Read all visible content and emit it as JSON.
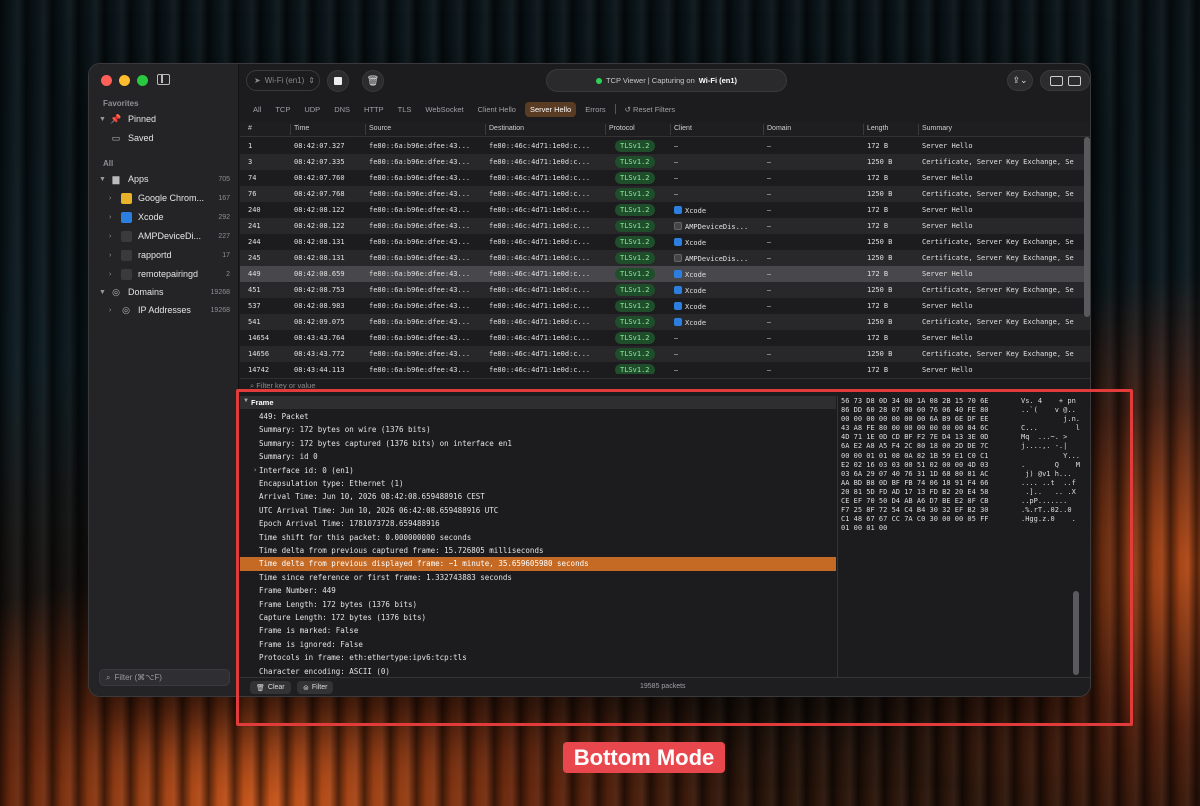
{
  "sidebar": {
    "favorites_heading": "Favorites",
    "pinned": "Pinned",
    "saved": "Saved",
    "all_heading": "All",
    "apps": {
      "label": "Apps",
      "count": "705"
    },
    "app_items": [
      {
        "label": "Google Chrom...",
        "count": "167",
        "color": "#e8b32a"
      },
      {
        "label": "Xcode",
        "count": "292",
        "color": "#2a7fe0"
      },
      {
        "label": "AMPDeviceDi...",
        "count": "227",
        "color": "#3a3a3a"
      },
      {
        "label": "rapportd",
        "count": "17",
        "color": "#3a3a3a"
      },
      {
        "label": "remotepairingd",
        "count": "2",
        "color": "#3a3a3a"
      }
    ],
    "domains": {
      "label": "Domains",
      "count": "19268"
    },
    "ip": {
      "label": "IP Addresses",
      "count": "19268"
    },
    "filter_placeholder": "Filter (⌘⌥F)"
  },
  "toolbar": {
    "interface": "Wi-Fi (en1)",
    "status_prefix": "TCP Viewer | Capturing on",
    "status_iface": "Wi-Fi (en1)"
  },
  "tabs": [
    "All",
    "TCP",
    "UDP",
    "DNS",
    "HTTP",
    "TLS",
    "WebSocket",
    "Client Hello",
    "Server Hello",
    "Errors"
  ],
  "reset_filters": "Reset Filters",
  "table": {
    "headers": [
      "#",
      "Time",
      "Source",
      "Destination",
      "Protocol",
      "Client",
      "Domain",
      "Length",
      "Summary"
    ],
    "rows": [
      {
        "n": "1",
        "time": "08:42:07.327",
        "src": "fe80::6a:b96e:dfee:43...",
        "dst": "fe80::46c:4d71:1e0d:c...",
        "proto": "TLSv1.2",
        "client": "–",
        "client_icon": "",
        "domain": "–",
        "len": "172 B",
        "summary": "Server Hello"
      },
      {
        "n": "3",
        "time": "08:42:07.335",
        "src": "fe80::6a:b96e:dfee:43...",
        "dst": "fe80::46c:4d71:1e0d:c...",
        "proto": "TLSv1.2",
        "client": "–",
        "client_icon": "",
        "domain": "–",
        "len": "1250 B",
        "summary": "Certificate, Server Key Exchange, Se"
      },
      {
        "n": "74",
        "time": "08:42:07.760",
        "src": "fe80::6a:b96e:dfee:43...",
        "dst": "fe80::46c:4d71:1e0d:c...",
        "proto": "TLSv1.2",
        "client": "–",
        "client_icon": "",
        "domain": "–",
        "len": "172 B",
        "summary": "Server Hello"
      },
      {
        "n": "76",
        "time": "08:42:07.768",
        "src": "fe80::6a:b96e:dfee:43...",
        "dst": "fe80::46c:4d71:1e0d:c...",
        "proto": "TLSv1.2",
        "client": "–",
        "client_icon": "",
        "domain": "–",
        "len": "1250 B",
        "summary": "Certificate, Server Key Exchange, Se"
      },
      {
        "n": "240",
        "time": "08:42:08.122",
        "src": "fe80::6a:b96e:dfee:43...",
        "dst": "fe80::46c:4d71:1e0d:c...",
        "proto": "TLSv1.2",
        "client": "Xcode",
        "client_icon": "xc",
        "domain": "–",
        "len": "172 B",
        "summary": "Server Hello"
      },
      {
        "n": "241",
        "time": "08:42:08.122",
        "src": "fe80::6a:b96e:dfee:43...",
        "dst": "fe80::46c:4d71:1e0d:c...",
        "proto": "TLSv1.2",
        "client": "AMPDeviceDis...",
        "client_icon": "amp",
        "domain": "–",
        "len": "172 B",
        "summary": "Server Hello"
      },
      {
        "n": "244",
        "time": "08:42:08.131",
        "src": "fe80::6a:b96e:dfee:43...",
        "dst": "fe80::46c:4d71:1e0d:c...",
        "proto": "TLSv1.2",
        "client": "Xcode",
        "client_icon": "xc",
        "domain": "–",
        "len": "1250 B",
        "summary": "Certificate, Server Key Exchange, Se"
      },
      {
        "n": "245",
        "time": "08:42:08.131",
        "src": "fe80::6a:b96e:dfee:43...",
        "dst": "fe80::46c:4d71:1e0d:c...",
        "proto": "TLSv1.2",
        "client": "AMPDeviceDis...",
        "client_icon": "amp",
        "domain": "–",
        "len": "1250 B",
        "summary": "Certificate, Server Key Exchange, Se"
      },
      {
        "n": "449",
        "time": "08:42:08.659",
        "src": "fe80::6a:b96e:dfee:43...",
        "dst": "fe80::46c:4d71:1e0d:c...",
        "proto": "TLSv1.2",
        "client": "Xcode",
        "client_icon": "xc",
        "domain": "–",
        "len": "172 B",
        "summary": "Server Hello"
      },
      {
        "n": "451",
        "time": "08:42:08.753",
        "src": "fe80::6a:b96e:dfee:43...",
        "dst": "fe80::46c:4d71:1e0d:c...",
        "proto": "TLSv1.2",
        "client": "Xcode",
        "client_icon": "xc",
        "domain": "–",
        "len": "1250 B",
        "summary": "Certificate, Server Key Exchange, Se"
      },
      {
        "n": "537",
        "time": "08:42:08.983",
        "src": "fe80::6a:b96e:dfee:43...",
        "dst": "fe80::46c:4d71:1e0d:c...",
        "proto": "TLSv1.2",
        "client": "Xcode",
        "client_icon": "xc",
        "domain": "–",
        "len": "172 B",
        "summary": "Server Hello"
      },
      {
        "n": "541",
        "time": "08:42:09.075",
        "src": "fe80::6a:b96e:dfee:43...",
        "dst": "fe80::46c:4d71:1e0d:c...",
        "proto": "TLSv1.2",
        "client": "Xcode",
        "client_icon": "xc",
        "domain": "–",
        "len": "1250 B",
        "summary": "Certificate, Server Key Exchange, Se"
      },
      {
        "n": "14654",
        "time": "08:43:43.764",
        "src": "fe80::6a:b96e:dfee:43...",
        "dst": "fe80::46c:4d71:1e0d:c...",
        "proto": "TLSv1.2",
        "client": "–",
        "client_icon": "",
        "domain": "–",
        "len": "172 B",
        "summary": "Server Hello"
      },
      {
        "n": "14656",
        "time": "08:43:43.772",
        "src": "fe80::6a:b96e:dfee:43...",
        "dst": "fe80::46c:4d71:1e0d:c...",
        "proto": "TLSv1.2",
        "client": "–",
        "client_icon": "",
        "domain": "–",
        "len": "1250 B",
        "summary": "Certificate, Server Key Exchange, Se"
      },
      {
        "n": "14742",
        "time": "08:43:44.113",
        "src": "fe80::6a:b96e:dfee:43...",
        "dst": "fe80::46c:4d71:1e0d:c...",
        "proto": "TLSv1.2",
        "client": "–",
        "client_icon": "",
        "domain": "–",
        "len": "172 B",
        "summary": "Server Hello"
      }
    ]
  },
  "filter_key_placeholder": "Filter key or value",
  "detail": {
    "frame_label": "Frame",
    "lines": [
      "449: Packet",
      "Summary: 172 bytes on wire (1376 bits)",
      "Summary: 172 bytes captured (1376 bits) on interface en1",
      "Summary: id 0",
      "Interface id: 0 (en1)",
      "Encapsulation type: Ethernet (1)",
      "Arrival Time: Jun 10, 2026 08:42:08.659488916 CEST",
      "UTC Arrival Time: Jun 10, 2026 06:42:08.659488916 UTC",
      "Epoch Arrival Time: 1781073728.659488916",
      "Time shift for this packet: 0.000000000 seconds",
      "Time delta from previous captured frame: 15.726805 milliseconds",
      "Time delta from previous displayed frame: −1 minute, 35.659605980 seconds",
      "Time since reference or first frame: 1.332743883 seconds",
      "Frame Number: 449",
      "Frame Length: 172 bytes (1376 bits)",
      "Capture Length: 172 bytes (1376 bits)",
      "Frame is marked: False",
      "Frame is ignored: False",
      "Protocols in frame: eth:ethertype:ipv6:tcp:tls",
      "Character encoding: ASCII (0)"
    ]
  },
  "hex": {
    "bytes": "56 73 D8 0D 34 00 1A 08 2B 15 70 6E\n86 DD 60 28 07 00 00 76 06 40 FE 80\n00 00 00 00 00 00 00 6A B9 6E DF EE\n43 A8 FE 80 00 00 00 00 00 00 04 6C\n4D 71 1E 0D CD BF F2 7E D4 13 3E 0D\n6A E2 A8 A5 F4 2C 80 18 00 2D DE 7C\n00 00 01 01 08 0A 82 1B 59 E1 C0 C1\nE2 02 16 03 03 00 51 02 00 00 4D 03\n03 6A 29 07 40 76 31 1D 68 80 81 AC\nAA BD B8 0D BF FB 74 06 18 91 F4 66\n20 81 5D FD AD 17 13 FD B2 20 E4 58\nCE EF 70 50 D4 AB A6 D7 BE E2 8F CB\nF7 25 8F 72 54 C4 B4 30 32 EF B2 30\nC1 48 67 67 CC 7A C0 30 00 00 05 FF\n01 00 01 00",
    "ascii": "Vs. 4    + pn\n..`(    v @..\n          j.n..\nC...         l\nMq  ...~. >\nj....,. -.|\n          Y...\n.       Q    M\n j) @v1 h...\n.... ..t  ..f\n .]..   .. .X\n..pP.......\n.%.rT..02..0\n.Hgg.z.0    .\n"
  },
  "bottom": {
    "clear": "Clear",
    "filter": "Filter",
    "packets": "19585 packets"
  },
  "annotation": "Bottom Mode"
}
